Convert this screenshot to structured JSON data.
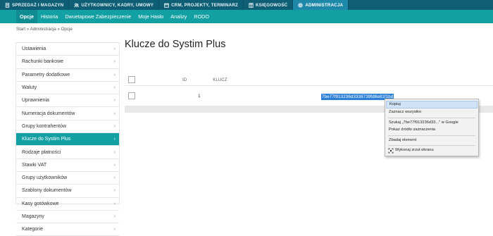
{
  "top_tabs": [
    {
      "label": "SPRZEDAŻ I MAGAZYN",
      "icon": "document-icon",
      "active": false
    },
    {
      "label": "UŻYTKOWNICY, KADRY, UMOWY",
      "icon": "users-icon",
      "active": false
    },
    {
      "label": "CRM, PROJEKTY, TERMINARZ",
      "icon": "calendar-icon",
      "active": false
    },
    {
      "label": "KSIĘGOWOŚĆ",
      "icon": "ledger-icon",
      "active": false
    },
    {
      "label": "ADMINISTRACJA",
      "icon": "gear-icon",
      "active": true
    }
  ],
  "sub_tabs": [
    {
      "label": "Opcje",
      "active": true
    },
    {
      "label": "Historia",
      "active": false
    },
    {
      "label": "Dwuetapowe Zabezpieczenie",
      "active": false
    },
    {
      "label": "Moje Hasło",
      "active": false
    },
    {
      "label": "Analizy",
      "active": false
    },
    {
      "label": "RODO",
      "active": false
    }
  ],
  "breadcrumb": "Start » Administracja » Opcje",
  "sidebar": {
    "items": [
      {
        "label": "Ustawienia"
      },
      {
        "label": "Rachunki bankowe"
      },
      {
        "label": "Parametry dodatkowe"
      },
      {
        "label": "Waluty"
      },
      {
        "label": "Uprawnienia"
      },
      {
        "label": "Numeracja dokumentów"
      },
      {
        "label": "Grupy kontrahentów"
      },
      {
        "label": "Klucze do Systim Plus",
        "active": true
      },
      {
        "label": "Rodzaje płatności"
      },
      {
        "label": "Stawki VAT"
      },
      {
        "label": "Grupy użytkowników"
      },
      {
        "label": "Szablony dokumentów"
      },
      {
        "label": "Kasy gotówkowe"
      },
      {
        "label": "Magazyny"
      },
      {
        "label": "Kategorie"
      }
    ],
    "chevron": "›"
  },
  "page_title": "Klucze do Systim Plus",
  "table": {
    "headers": {
      "id": "ID",
      "key": "KLUCZ"
    },
    "rows": [
      {
        "id": "1",
        "key": "7be77f913236d3338739fd8e81f1bd"
      }
    ]
  },
  "context_menu": {
    "items": [
      {
        "label": "Kopiuj",
        "highlighted": true
      },
      {
        "label": "Zaznacz wszystko"
      },
      {
        "label": "Szukaj „7be77f913236d33...\" w Google"
      },
      {
        "label": "Pokaż źródło zaznaczenia"
      },
      {
        "label": "Zbadaj element"
      },
      {
        "label": "Wykonaj zrzut ekranu",
        "icon": "screenshot-icon"
      }
    ]
  },
  "colors": {
    "topbar": "#0e5f75",
    "topbar_active": "#1e88a8",
    "subbar": "#13a0a3",
    "sidebar_active": "#13a0a3",
    "selection": "#2b7fd6"
  }
}
